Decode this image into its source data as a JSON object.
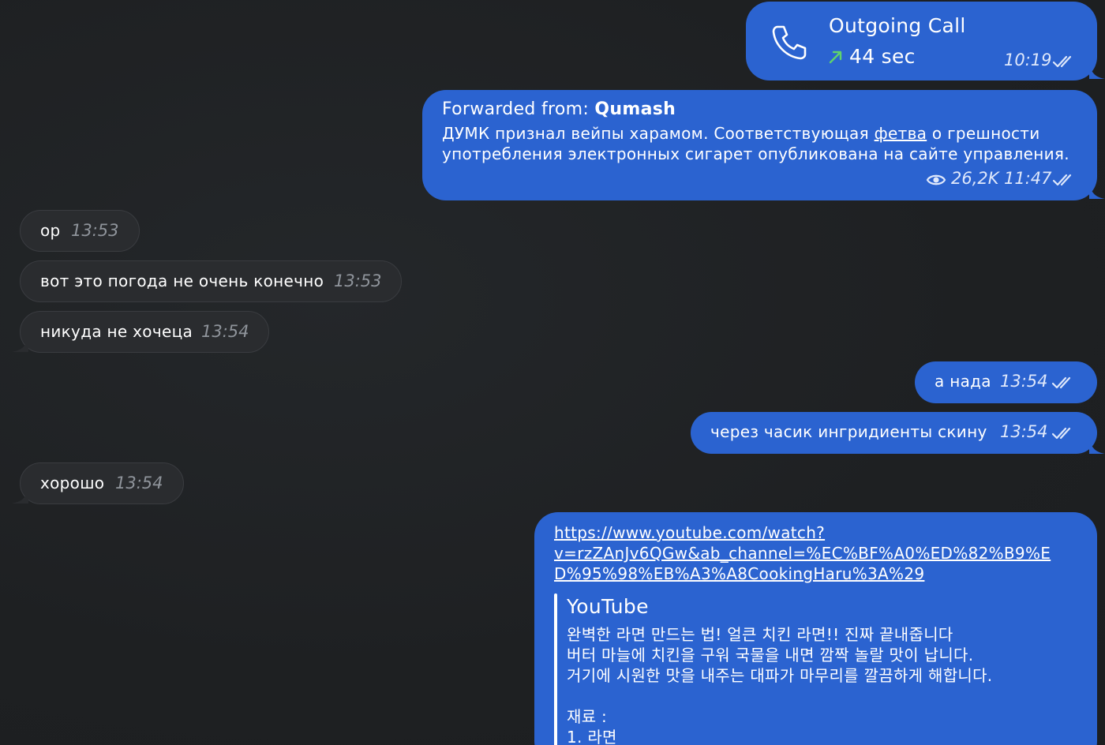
{
  "colors": {
    "outgoing_bubble": "#2b63d0",
    "incoming_bubble": "#2a2c2f",
    "background": "#1f2123",
    "call_arrow": "#5fd36b",
    "preview_bar": "#ffffff"
  },
  "call": {
    "icon": "phone-icon",
    "title": "Outgoing Call",
    "arrow_icon": "arrow-up-right-icon",
    "duration": "44 sec",
    "time": "10:19"
  },
  "forward": {
    "prefix": "Forwarded from: ",
    "source": "Qumash",
    "line1_before": "ДУМК признал вейпы харамом. Соответствующая ",
    "link_word": "фетва",
    "line1_after": " о грешности",
    "line2": "употребления электронных сигарет опубликована на сайте управления.",
    "views_icon": "eye-icon",
    "views": "26,2K",
    "time": "11:47"
  },
  "messages": {
    "m1": {
      "text": "ор",
      "time": "13:53"
    },
    "m2": {
      "text": "вот это погода не очень конечно",
      "time": "13:53"
    },
    "m3": {
      "text": "никуда не хочеца",
      "time": "13:54"
    },
    "m4": {
      "text": "а нада",
      "time": "13:54"
    },
    "m5": {
      "text": "через часик ингридиенты скину",
      "time": "13:54"
    },
    "m6": {
      "text": "хорошо",
      "time": "13:54"
    }
  },
  "youtube": {
    "url_line1": "https://www.youtube.com/watch?",
    "url_line2": "v=rzZAnJv6QGw&ab_channel=%EC%BF%A0%ED%82%B9%E",
    "url_line3": "D%95%98%EB%A3%A8CookingHaru%3A%29",
    "site": "YouTube",
    "title": "완벽한 라면 만드는 법! 얼큰 치킨 라면!! 진짜 끝내줍니다",
    "desc1": "버터 마늘에 치킨을 구워 국물을 내면 깜짝 놀랄 맛이 납니다.",
    "desc2": "거기에 시원한 맛을 내주는 대파가 마무리를 깔끔하게 해합니다.",
    "ingredients_label": "재료 :",
    "ingredient1": "1. 라면"
  }
}
